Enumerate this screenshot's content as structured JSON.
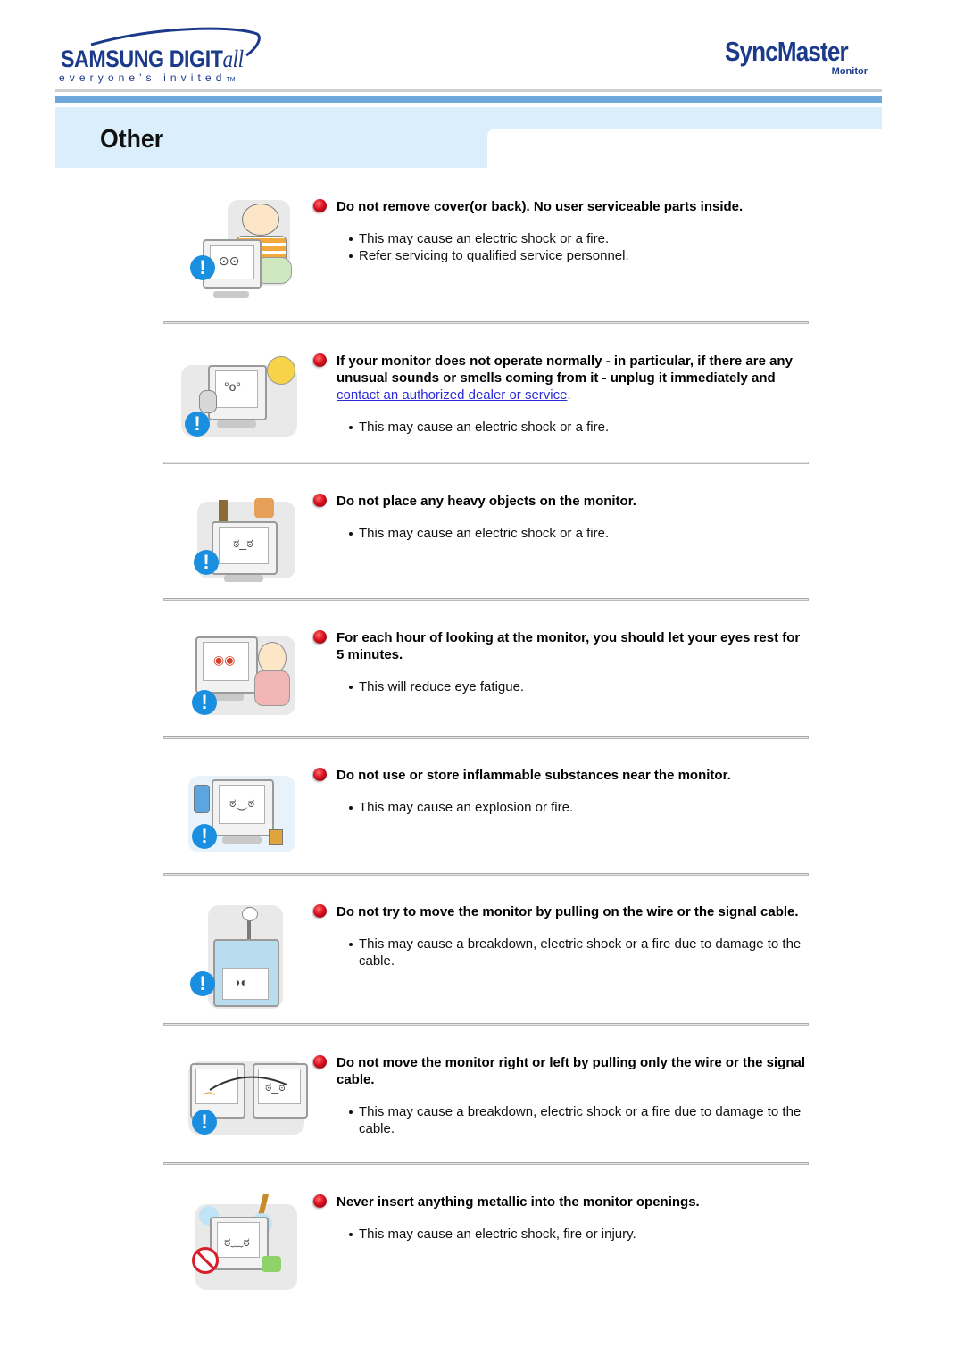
{
  "header": {
    "brand_left": {
      "wordmark": "SAMSUNG DIGIT",
      "wordmark_suffix": "all",
      "tagline": "everyone's invited",
      "trademark": "TM"
    },
    "brand_right": {
      "wordmark": "SyncMaster",
      "subtitle": "Monitor"
    },
    "colors": {
      "brand": "#1b3a8a",
      "rule_blue": "#6fa8dc",
      "title_band": "#dbeefb",
      "link": "#2b2bd8",
      "bullet_dot": "#d8101e"
    }
  },
  "page": {
    "title": "Other"
  },
  "items": [
    {
      "illustration": "man-opening-monitor-back",
      "heading": "Do not remove cover(or back). No user serviceable parts inside.",
      "bullets": [
        "This may cause an electric shock or a fire.",
        "Refer servicing to qualified service personnel."
      ]
    },
    {
      "illustration": "monitor-smoking-unplug",
      "heading": "If your monitor does not operate normally - in particular, if there are any unusual sounds or smells coming from it - unplug it immediately and",
      "heading_link": "contact an authorized dealer or service",
      "heading_tail": ".",
      "bullets": [
        "This may cause an electric shock or a fire."
      ]
    },
    {
      "illustration": "heavy-objects-on-monitor",
      "heading": "Do not place any heavy objects on the monitor.",
      "bullets": [
        "This may cause an electric shock or a fire."
      ]
    },
    {
      "illustration": "woman-resting-eyes",
      "heading": "For each hour of looking at the monitor, you should let your eyes rest for 5 minutes.",
      "bullets": [
        "This will reduce eye fatigue."
      ]
    },
    {
      "illustration": "inflammable-substances",
      "heading": "Do not use or store inflammable substances near the monitor.",
      "bullets": [
        "This may cause an explosion or fire."
      ]
    },
    {
      "illustration": "pulling-monitor-by-cable",
      "heading": "Do not try to move the monitor by pulling on the wire or the signal cable.",
      "bullets": [
        "This may cause a breakdown, electric shock or a fire due to damage to the cable."
      ]
    },
    {
      "illustration": "moving-monitor-left-right-by-wire",
      "heading": "Do not move the monitor right or left by pulling only the wire or the signal cable.",
      "bullets": [
        "This may cause a breakdown, electric shock or a fire due to damage to the cable."
      ]
    },
    {
      "illustration": "metal-object-into-openings",
      "heading": "Never insert anything metallic into the monitor openings.",
      "bullets": [
        "This may cause an electric shock, fire or injury."
      ]
    }
  ]
}
